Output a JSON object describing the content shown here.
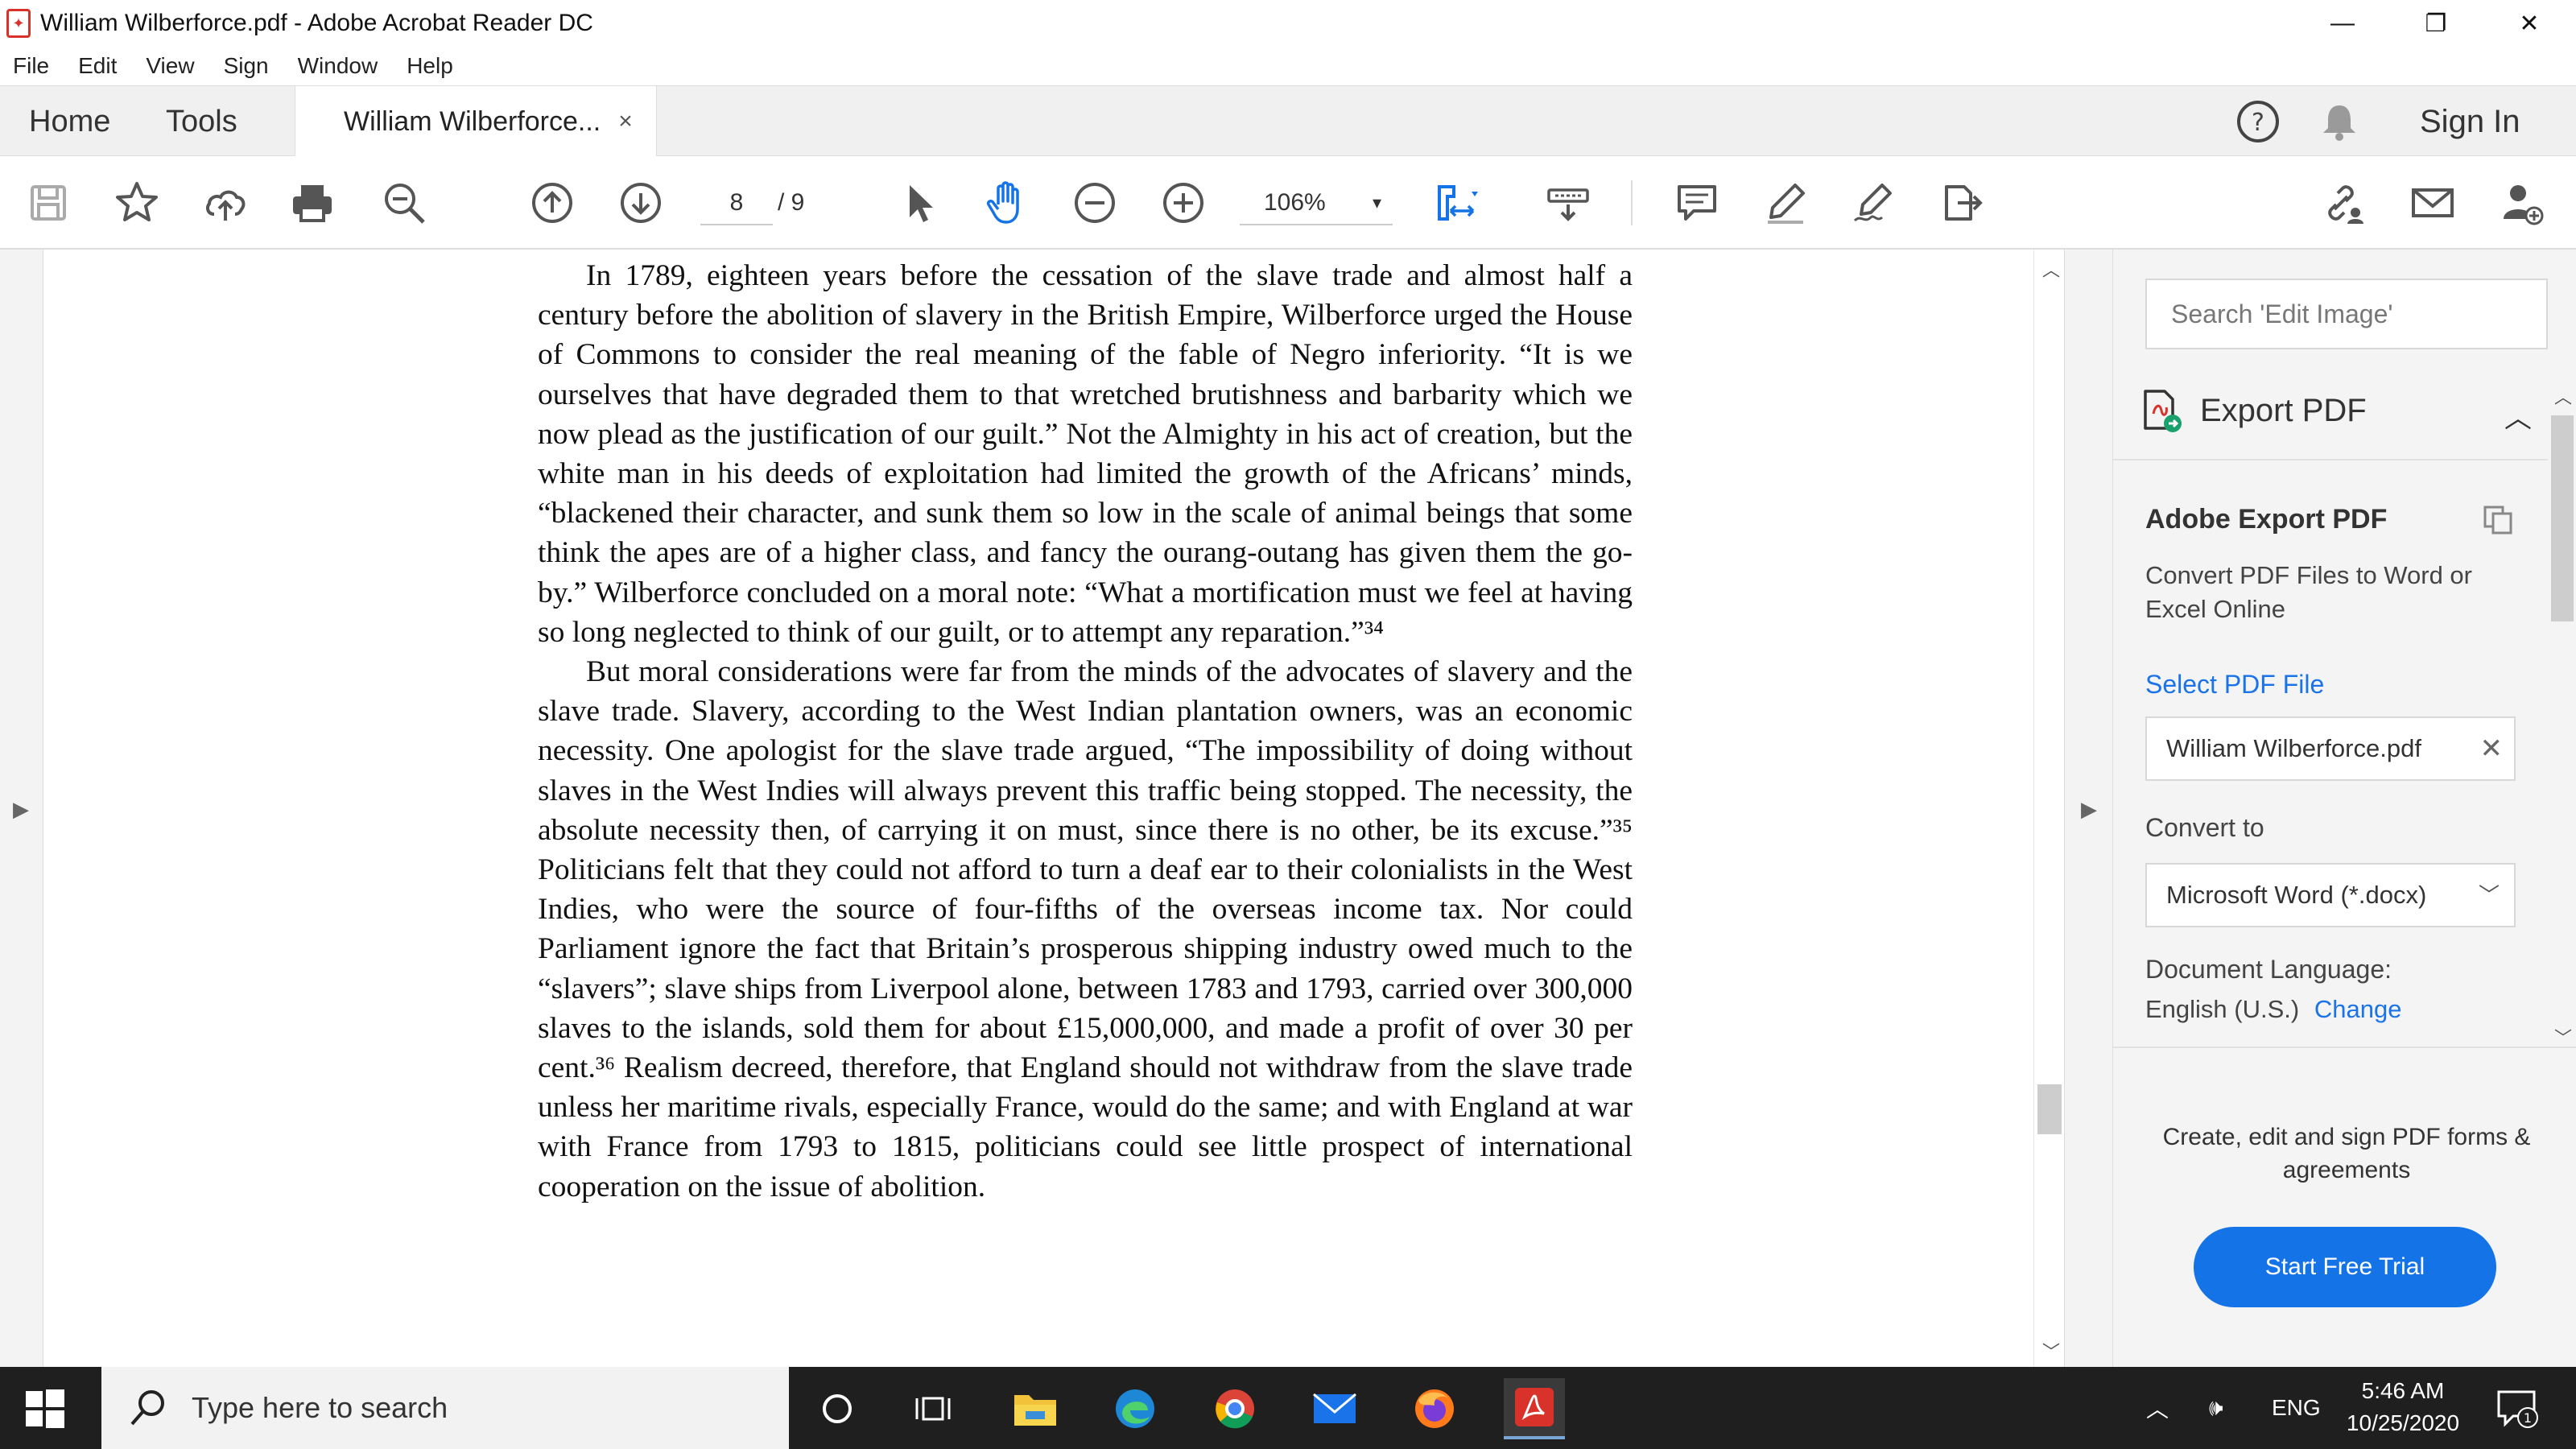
{
  "window": {
    "title": "William Wilberforce.pdf - Adobe Acrobat Reader DC",
    "minimize": "—",
    "restore": "❐",
    "close": "✕"
  },
  "menu": [
    "File",
    "Edit",
    "View",
    "Sign",
    "Window",
    "Help"
  ],
  "tabs": {
    "home": "Home",
    "tools": "Tools",
    "document": "William Wilberforce...",
    "close": "×",
    "help": "?",
    "sign_in": "Sign In"
  },
  "toolbar": {
    "page_current": "8",
    "page_total": "/ 9",
    "zoom": "106%",
    "zoom_caret": "▾"
  },
  "document": {
    "paragraphs": [
      "In 1789, eighteen years before the cessation of the slave trade and almost half a century before the abolition of slavery in the British Empire, Wilberforce urged the House of Commons to consider the real meaning of the fable of Negro inferiority. “It is we ourselves that have degraded them to that wretched brutishness and barbarity which we now plead as the justification of our guilt.” Not the Almighty in his act of creation, but the white man in his deeds of exploitation had limited the growth of the Africans’ minds, “blackened their character, and sunk them so low in the scale of animal beings that some think the apes are of a higher class, and fancy the ourang-outang has given them the go-by.” Wilberforce concluded on a moral note: “What a mortification must we feel at having so long neglected to think of our guilt, or to attempt any reparation.”³⁴",
      "But moral considerations were far from the minds of the advocates of slavery and the slave trade. Slavery, according to the West Indian plantation owners, was an economic necessity. One apologist for the slave trade argued, “The impossibility of doing without slaves in the West Indies will always prevent this traffic being stopped. The necessity, the absolute necessity then, of carrying it on must, since there is no other, be its excuse.”³⁵ Politicians felt that they could not afford to turn a deaf ear to their colonialists in the West Indies, who were the source of four-fifths of the overseas income tax. Nor could Parliament ignore the fact that Britain’s prosperous shipping industry owed much to the “slavers”; slave ships from Liverpool alone, between 1783 and 1793, carried over 300,000 slaves to the islands, sold them for about £15,000,000, and made a profit of over 30 per cent.³⁶ Realism decreed, therefore, that England should not withdraw from the slave trade unless her maritime rivals, especially France, would do the same; and with England at war with France from 1793 to 1815, politicians could see little prospect of international cooperation on the issue of abolition."
    ],
    "left_arrow": "▶",
    "right_arrow": "▶",
    "scroll_up": "︿",
    "scroll_down": "﹀",
    "scroll_position": 0.8
  },
  "pane": {
    "search_placeholder": "Search 'Edit Image'",
    "export_title": "Export PDF",
    "collapse": "︿",
    "section_title": "Adobe Export PDF",
    "description": "Convert PDF Files to Word or Excel Online",
    "select_link": "Select PDF File",
    "file_name": "William Wilberforce.pdf",
    "file_clear": "✕",
    "convert_label": "Convert to",
    "convert_value": "Microsoft Word (*.docx)",
    "convert_caret": "﹀",
    "language_label": "Document Language:",
    "language_value": "English (U.S.)",
    "language_change": "Change",
    "promo": "Create, edit and sign PDF forms & agreements",
    "trial_button": "Start Free Trial",
    "scroll_up": "︿",
    "scroll_down": "﹀"
  },
  "taskbar": {
    "search_placeholder": "Type here to search",
    "tray_chevron": "︿",
    "volume": "🕪",
    "lang": "ENG",
    "time": "5:46 AM",
    "date": "10/25/2020",
    "notification_count": "1"
  },
  "colors": {
    "accent_blue": "#1473e6",
    "link_blue": "#1a73e8",
    "acrobat_red": "#d9322b",
    "taskbar_bg": "#1f1f1f"
  }
}
